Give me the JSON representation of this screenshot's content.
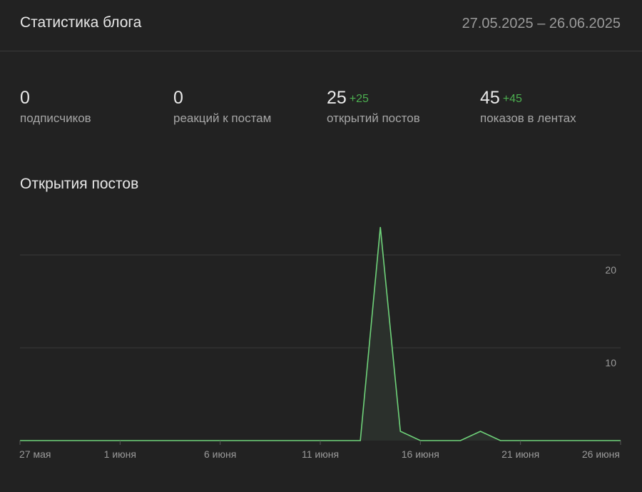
{
  "header": {
    "title": "Статистика блога",
    "date_range": "27.05.2025 – 26.06.2025"
  },
  "stats": [
    {
      "value": "0",
      "delta": "",
      "label": "подписчиков"
    },
    {
      "value": "0",
      "delta": "",
      "label": "реакций к постам"
    },
    {
      "value": "25",
      "delta": "+25",
      "label": "открытий постов"
    },
    {
      "value": "45",
      "delta": "+45",
      "label": "показов в лентах"
    }
  ],
  "section": {
    "title": "Открытия постов"
  },
  "colors": {
    "accent": "#4caf50",
    "line": "#6fd37a",
    "grid": "#3a3a3a"
  },
  "chart_data": {
    "type": "area",
    "x_ticks": [
      "27 мая",
      "1 июня",
      "6 июня",
      "11 июня",
      "16 июня",
      "21 июня",
      "26 июня"
    ],
    "y_ticks": [
      "10",
      "20"
    ],
    "ylim": [
      0,
      25
    ],
    "grid": true,
    "series": [
      {
        "values": [
          0,
          0,
          0,
          0,
          0,
          0,
          0,
          0,
          0,
          0,
          0,
          0,
          0,
          0,
          0,
          0,
          0,
          0,
          23,
          1,
          0,
          0,
          0,
          1,
          0,
          0,
          0,
          0,
          0,
          0,
          0
        ]
      }
    ]
  }
}
